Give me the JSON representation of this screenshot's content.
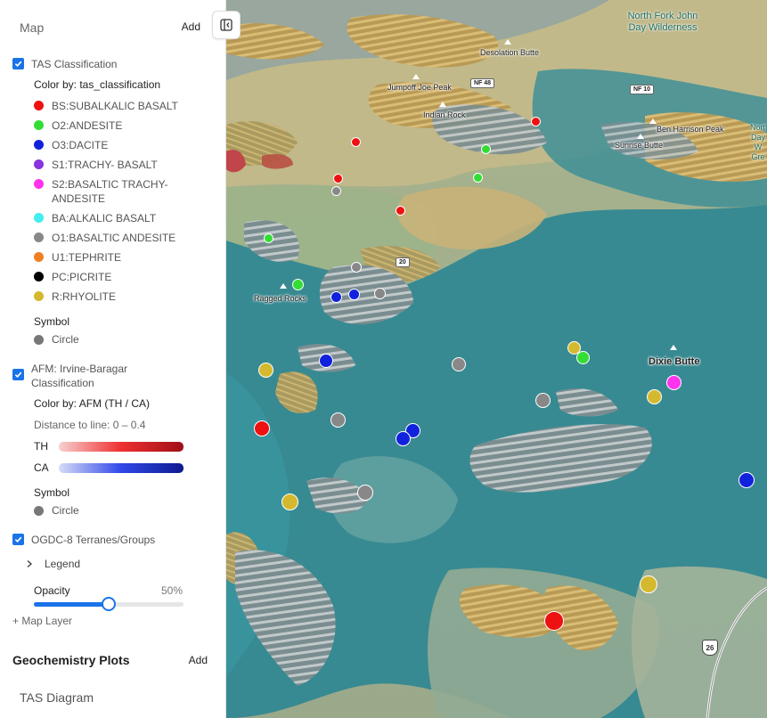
{
  "sidebar": {
    "header": "Map",
    "add_label": "Add",
    "layers": {
      "tas": {
        "title": "TAS Classification",
        "checked": true,
        "color_by": "Color by: tas_classification",
        "legend": [
          {
            "label": "BS:SUBALKALIC BASALT",
            "color": "#ee1111"
          },
          {
            "label": "O2:ANDESITE",
            "color": "#33dd33"
          },
          {
            "label": "O3:DACITE",
            "color": "#1122dd"
          },
          {
            "label": "S1:TRACHY- BASALT",
            "color": "#8833dd"
          },
          {
            "label": "S2:BASALTIC TRACHY-ANDESITE",
            "color": "#ff33ee"
          },
          {
            "label": "BA:ALKALIC BASALT",
            "color": "#44eeee"
          },
          {
            "label": "O1:BASALTIC ANDESITE",
            "color": "#888888"
          },
          {
            "label": "U1:TEPHRITE",
            "color": "#f07f22"
          },
          {
            "label": "PC:PICRITE",
            "color": "#000000"
          },
          {
            "label": "R:RHYOLITE",
            "color": "#d4b92e"
          }
        ],
        "symbol_label": "Symbol",
        "symbol_value": "Circle"
      },
      "afm": {
        "title": "AFM: Irvine-Baragar Classification",
        "checked": true,
        "color_by": "Color by: AFM (TH / CA)",
        "distance": "Distance to line: 0 – 0.4",
        "th_label": "TH",
        "ca_label": "CA",
        "th_color": "#b01018",
        "ca_color": "#1020a0",
        "symbol_label": "Symbol",
        "symbol_value": "Circle"
      },
      "ogdc": {
        "title": "OGDC-8 Terranes/Groups",
        "checked": true,
        "legend_label": "Legend",
        "opacity_label": "Opacity",
        "opacity_value": "50%",
        "opacity_fraction": 0.5
      }
    },
    "map_layer_button": "+ Map Layer",
    "geochem": {
      "title": "Geochemistry Plots",
      "add_label": "Add",
      "items": [
        "TAS Diagram"
      ]
    }
  },
  "map": {
    "places": {
      "wilderness": "North Fork John Day Wilderness",
      "desolation": "Desolation Butte",
      "jumpoff": "Jumpoff Joe Peak",
      "indian": "Indian Rock",
      "ben_harrison": "Ben Harrison Peak",
      "sunrise": "Sunrise Butte",
      "ragged": "Ragged Rocks",
      "dixie": "Dixie Butte",
      "edge_text": "North Day W Gre"
    },
    "roads": {
      "nf48": "NF 48",
      "nf10": "NF 10",
      "r20": "20",
      "us26": "26"
    },
    "accent_color": "#1a73e8"
  }
}
